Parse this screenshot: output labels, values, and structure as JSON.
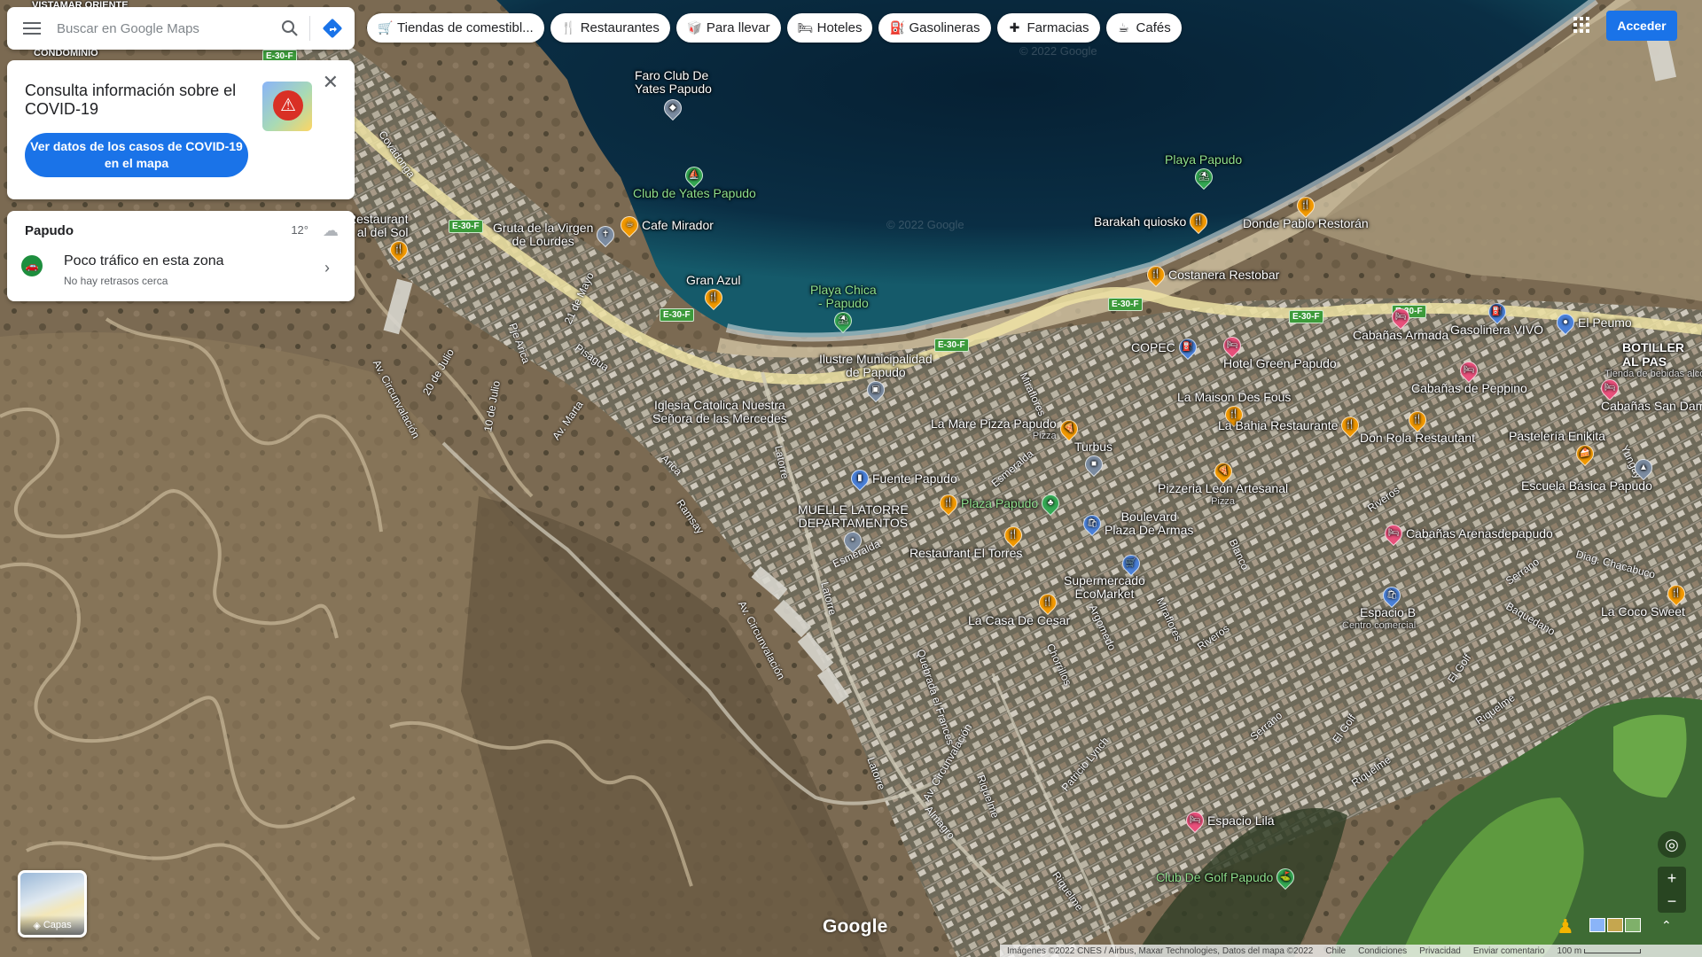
{
  "search": {
    "placeholder": "Buscar en Google Maps"
  },
  "chips": [
    {
      "icon": "shopping-cart-icon",
      "glyph": "🛒",
      "label": "Tiendas de comestibl..."
    },
    {
      "icon": "restaurant-icon",
      "glyph": "🍴",
      "label": "Restaurantes"
    },
    {
      "icon": "takeout-icon",
      "glyph": "🥡",
      "label": "Para llevar"
    },
    {
      "icon": "hotel-icon",
      "glyph": "🛏",
      "label": "Hoteles"
    },
    {
      "icon": "gas-station-icon",
      "glyph": "⛽",
      "label": "Gasolineras"
    },
    {
      "icon": "pharmacy-icon",
      "glyph": "✚",
      "label": "Farmacias"
    },
    {
      "icon": "cafe-icon",
      "glyph": "☕",
      "label": "Cafés"
    }
  ],
  "covid": {
    "title": "Consulta información sobre el COVID-19",
    "button": "Ver datos de los casos de COVID-19 en el mapa"
  },
  "area": {
    "name": "Papudo",
    "temperature": "12°",
    "traffic_title": "Poco tráfico en esta zona",
    "traffic_sub": "No hay retrasos cerca"
  },
  "signin": "Acceder",
  "layers_label": "Capas",
  "google_logo": "Google",
  "attribution": {
    "imagery": "Imágenes ©2022 CNES / Airbus, Maxar Technologies, Datos del mapa ©2022",
    "country": "Chile",
    "terms": "Condiciones",
    "privacy": "Privacidad",
    "feedback": "Enviar comentario",
    "scale": "100 m"
  },
  "watermark": "© 2022 Google",
  "colors": {
    "accent": "#1a73e8",
    "restaurant_pin": "#f29900",
    "hotel_pin": "#e8507b",
    "service_pin": "#4a80d8",
    "park_pin": "#34a853",
    "landmark_pin": "#7b8ba0",
    "road_highlight": "#efe3a4"
  },
  "places": [
    {
      "name": "Faro Club De\nYates Papudo",
      "type": "landmark",
      "sub": ""
    },
    {
      "name": "Club de Yates Papudo",
      "type": "park",
      "sub": ""
    },
    {
      "name": "Cafe Mirador",
      "type": "restaurant",
      "sub": ""
    },
    {
      "name": "Gruta de la Virgen\nde Lourdes",
      "type": "landmark",
      "sub": ""
    },
    {
      "name": "Gran Azul",
      "type": "restaurant",
      "sub": ""
    },
    {
      "name": "Playa Chica\n- Papudo",
      "type": "park",
      "sub": ""
    },
    {
      "name": "Playa Papudo",
      "type": "park",
      "sub": ""
    },
    {
      "name": "Barakah quiosko",
      "type": "restaurant",
      "sub": ""
    },
    {
      "name": "Donde Pablo Restorán",
      "type": "restaurant",
      "sub": ""
    },
    {
      "name": "Costanera Restobar",
      "type": "restaurant",
      "sub": ""
    },
    {
      "name": "COPEC",
      "type": "service",
      "sub": ""
    },
    {
      "name": "Hotel Green Papudo",
      "type": "hotel",
      "sub": ""
    },
    {
      "name": "Cabañas Armada",
      "type": "hotel",
      "sub": ""
    },
    {
      "name": "Gasolinera VIVO",
      "type": "service",
      "sub": ""
    },
    {
      "name": "El Peumo",
      "type": "service",
      "sub": ""
    },
    {
      "name": "Ilustre Municipalidad\nde Papudo",
      "type": "landmark",
      "sub": ""
    },
    {
      "name": "Iglesia Catolica Nuestra\nSeñora de las Mercedes",
      "type": "landmark",
      "sub": ""
    },
    {
      "name": "La Mare Pizza Papudo",
      "type": "restaurant",
      "sub": "Pizza"
    },
    {
      "name": "Fuente Papudo",
      "type": "landmark",
      "sub": ""
    },
    {
      "name": "Plaza Papudo",
      "type": "park",
      "sub": ""
    },
    {
      "name": "Turbus",
      "type": "landmark",
      "sub": ""
    },
    {
      "name": "La Maison Des Fous",
      "type": "restaurant",
      "sub": ""
    },
    {
      "name": "La Bahia Restaurante",
      "type": "restaurant",
      "sub": ""
    },
    {
      "name": "Don Rola Restautant",
      "type": "restaurant",
      "sub": ""
    },
    {
      "name": "Cabañas de Peppino",
      "type": "hotel",
      "sub": ""
    },
    {
      "name": "Pastelería Enikita",
      "type": "restaurant",
      "sub": ""
    },
    {
      "name": "Cabañas San Dam",
      "type": "hotel",
      "sub": ""
    },
    {
      "name": "MUELLE LATORRE\nDEPARTAMENTOS",
      "type": "landmark",
      "sub": ""
    },
    {
      "name": "Pizzeria León Artesanal",
      "type": "restaurant",
      "sub": "Pizza"
    },
    {
      "name": "Boulevard\nPlaza De Armas",
      "type": "service",
      "sub": ""
    },
    {
      "name": "Restaurant El Torres",
      "type": "restaurant",
      "sub": ""
    },
    {
      "name": "Supermercado\nEcoMarket",
      "type": "service",
      "sub": ""
    },
    {
      "name": "La Casa De Cesar",
      "type": "restaurant",
      "sub": ""
    },
    {
      "name": "Escuela Básica Papudo",
      "type": "landmark",
      "sub": ""
    },
    {
      "name": "Cabañas Arenasdepapudo",
      "type": "hotel",
      "sub": ""
    },
    {
      "name": "Espacio B",
      "type": "service",
      "sub": "Centro comercial"
    },
    {
      "name": "La Coco Sweet",
      "type": "restaurant",
      "sub": ""
    },
    {
      "name": "Espacio Lila",
      "type": "hotel",
      "sub": ""
    },
    {
      "name": "Club De Golf Papudo",
      "type": "park",
      "sub": ""
    },
    {
      "name": "Restaurant\nal del Sol",
      "type": "restaurant",
      "sub": ""
    },
    {
      "name": "BOTILLER\nAL PAS",
      "type": "service",
      "sub": "Tienda de bebidas alcohólicas"
    }
  ],
  "streets": [
    "Covadonga",
    "21 de Mayo",
    "Pje Arica",
    "Pisagua",
    "20 de Julio",
    "10 de Julio",
    "Av. Circunvalación",
    "Av. Marta",
    "Arica",
    "Ramsay",
    "Latorre",
    "Esmeralda",
    "Miraflores",
    "Blanco",
    "Riveros",
    "Serrano",
    "El Golf",
    "Riquelme",
    "Baquedano",
    "Diag. Chacabuco",
    "Yungay",
    "Quebrada el Frances",
    "Almagro",
    "Patricio Lynch",
    "Chorrillos",
    "Argomedo",
    "Andes",
    "VISTAMAR ORIENTE",
    "CONDOMINIO"
  ],
  "road_shield": "E-30-F"
}
